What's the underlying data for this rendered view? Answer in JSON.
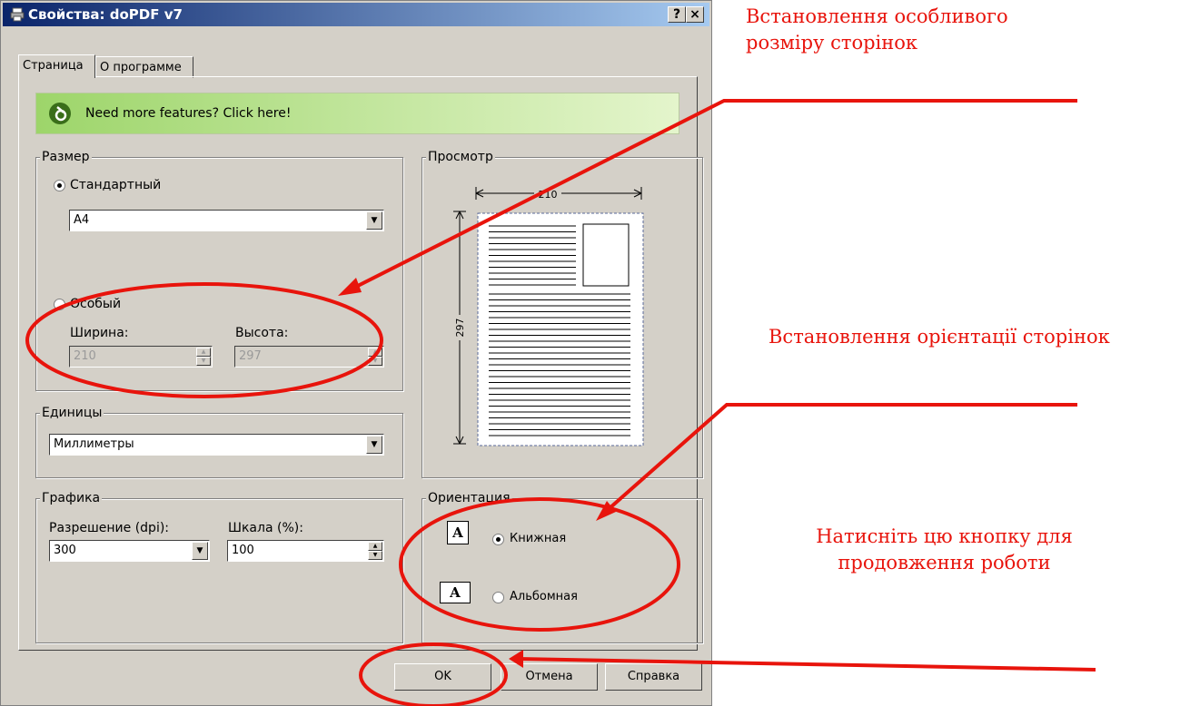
{
  "window": {
    "title": "Свойства: doPDF v7",
    "help_btn": "?",
    "close_btn": "×"
  },
  "tabs": [
    {
      "label": "Страница"
    },
    {
      "label": "О программе"
    }
  ],
  "banner": {
    "text": "Need more features? Click here!"
  },
  "size_group": {
    "label": "Размер",
    "standard_label": "Стандартный",
    "standard_value": "A4",
    "custom_label": "Особый",
    "width_label": "Ширина:",
    "height_label": "Высота:",
    "width_value": "210",
    "height_value": "297",
    "selected": "standard"
  },
  "units_group": {
    "label": "Единицы",
    "value": "Миллиметры"
  },
  "graphics_group": {
    "label": "Графика",
    "resolution_label": "Разрешение (dpi):",
    "resolution_value": "300",
    "scale_label": "Шкала (%):",
    "scale_value": "100"
  },
  "preview_group": {
    "label": "Просмотр",
    "width_dim": "210",
    "height_dim": "297"
  },
  "orientation_group": {
    "label": "Ориентация",
    "portrait_label": "Книжная",
    "landscape_label": "Альбомная",
    "icon_letter": "A",
    "selected": "portrait"
  },
  "buttons": {
    "ok": "OK",
    "cancel": "Отмена",
    "help": "Справка"
  },
  "annotations": {
    "a1_line1": "Встановлення особливого",
    "a1_line2": "розміру сторінок",
    "a2": "Встановлення орієнтації сторінок",
    "a3_line1": "Натисніть цю кнопку для",
    "a3_line2": "продовження роботи"
  },
  "colors": {
    "annotation": "#e8140c",
    "titlebar": "#0a246a",
    "banner": "#9dd56a"
  }
}
